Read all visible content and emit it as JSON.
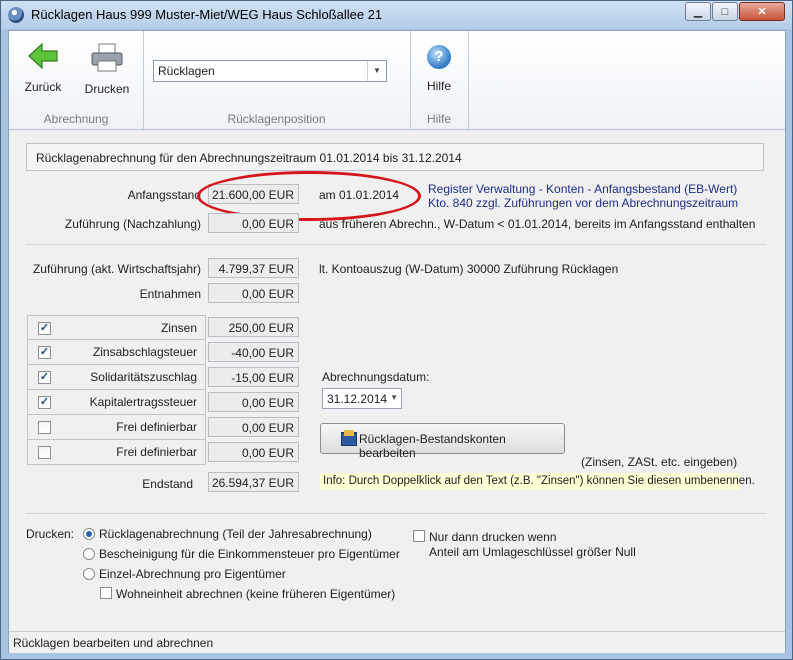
{
  "window": {
    "title": "Rücklagen Haus 999  Muster-Miet/WEG Haus Schloßallee 21",
    "min": "▁",
    "max": "□",
    "close": "✕"
  },
  "toolbar": {
    "back_label": "Zurück",
    "print_label": "Drucken",
    "help_label": "Hilfe",
    "combo_value": "Rücklagen",
    "group_abrechnung": "Abrechnung",
    "group_position": "Rücklagenposition",
    "group_help": "Hilfe"
  },
  "heading": "Rücklagenabrechnung für den Abrechnungszeitraum 01.01.2014 bis 31.12.2014",
  "anfang": {
    "label": "Anfangsstand",
    "value": "21.600,00 EUR",
    "date_text": "am 01.01.2014",
    "note1": "Register Verwaltung - Konten - Anfangsbestand (EB-Wert)",
    "note2": "Kto. 840  zzgl. Zuführungen vor dem Abrechnungszeitraum"
  },
  "zufuehrung_nach": {
    "label": "Zuführung (Nachzahlung)",
    "value": "0,00 EUR",
    "note": "aus früheren Abrechn., W-Datum < 01.01.2014, bereits im Anfangsstand enthalten"
  },
  "zufuehrung_akt": {
    "label": "Zuführung (akt. Wirtschaftsjahr)",
    "value": "4.799,37 EUR",
    "note": "lt. Kontoauszug (W-Datum) 30000 Zuführung Rücklagen"
  },
  "entnahmen": {
    "label": "Entnahmen",
    "value": "0,00 EUR"
  },
  "positions": [
    {
      "label": "Zinsen",
      "checked": true,
      "value": "250,00 EUR"
    },
    {
      "label": "Zinsabschlagsteuer",
      "checked": true,
      "value": "-40,00 EUR"
    },
    {
      "label": "Solidaritätszuschlag",
      "checked": true,
      "value": "-15,00 EUR"
    },
    {
      "label": "Kapitalertragssteuer",
      "checked": true,
      "value": "0,00 EUR"
    },
    {
      "label": "Frei definierbar",
      "checked": false,
      "value": "0,00 EUR"
    },
    {
      "label": "Frei definierbar",
      "checked": false,
      "value": "0,00 EUR"
    }
  ],
  "endstand": {
    "label": "Endstand",
    "value": "26.594,37 EUR"
  },
  "abrechnungsdatum": {
    "label": "Abrechnungsdatum:",
    "value": "31.12.2014"
  },
  "bestands_button": "Rücklagen-Bestandskonten bearbeiten",
  "bestands_hint": "(Zinsen, ZASt.  etc. eingeben)",
  "info": "Info: Durch Doppelklick auf den Text (z.B. \"Zinsen\") können  Sie diesen umbenennen.",
  "drucken": {
    "label": "Drucken:",
    "options": [
      "Rücklagenabrechnung (Teil der Jahresabrechnung)",
      "Bescheinigung für die Einkommensteuer pro Eigentümer",
      "Einzel-Abrechnung pro Eigentümer"
    ],
    "selected": 0,
    "wohneinheit": "Wohneinheit abrechnen (keine früheren Eigentümer)",
    "nur_dann_1": "Nur dann drucken wenn",
    "nur_dann_2": "Anteil am Umlageschlüssel größer Null"
  },
  "status": "Rücklagen bearbeiten und abrechnen"
}
